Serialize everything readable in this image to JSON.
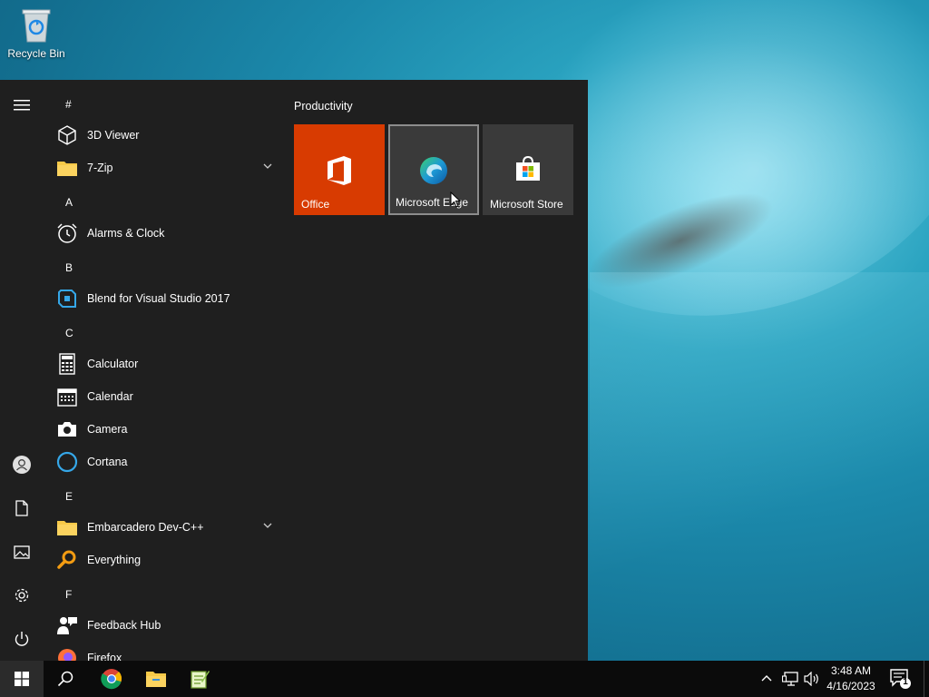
{
  "desktop": {
    "icons": [
      {
        "label": "Recycle Bin",
        "icon": "recycle-bin-icon"
      }
    ]
  },
  "start_menu": {
    "rail": [
      "hamburger-menu-icon",
      "user-icon",
      "documents-icon",
      "pictures-icon",
      "settings-icon",
      "power-icon"
    ],
    "app_list": {
      "letter_hash": "#",
      "letter_a": "A",
      "letter_b": "B",
      "letter_c": "C",
      "letter_e": "E",
      "letter_f": "F",
      "apps": {
        "viewer3d": "3D Viewer",
        "zip7": "7-Zip",
        "alarms": "Alarms & Clock",
        "blend": "Blend for Visual Studio 2017",
        "calculator": "Calculator",
        "calendar": "Calendar",
        "camera": "Camera",
        "cortana": "Cortana",
        "devcpp": "Embarcadero Dev-C++",
        "everything": "Everything",
        "feedback": "Feedback Hub",
        "firefox": "Firefox"
      }
    },
    "tiles": {
      "group_title": "Productivity",
      "office": {
        "label": "Office",
        "color": "#d83b01"
      },
      "edge": {
        "label": "Microsoft Edge",
        "color": "#3a3a3a"
      },
      "store": {
        "label": "Microsoft Store",
        "color": "#3a3a3a"
      }
    }
  },
  "taskbar": {
    "pinned": [
      "windows-start-icon",
      "search-icon",
      "chrome-icon",
      "file-explorer-icon",
      "notepad-plus-icon"
    ],
    "clock": {
      "time": "3:48 AM",
      "date": "4/16/2023"
    },
    "notification_count": "1"
  },
  "colors": {
    "accent_office": "#d83b01",
    "menu_bg": "#1f1f1f",
    "taskbar_bg": "#0b0b0b"
  }
}
